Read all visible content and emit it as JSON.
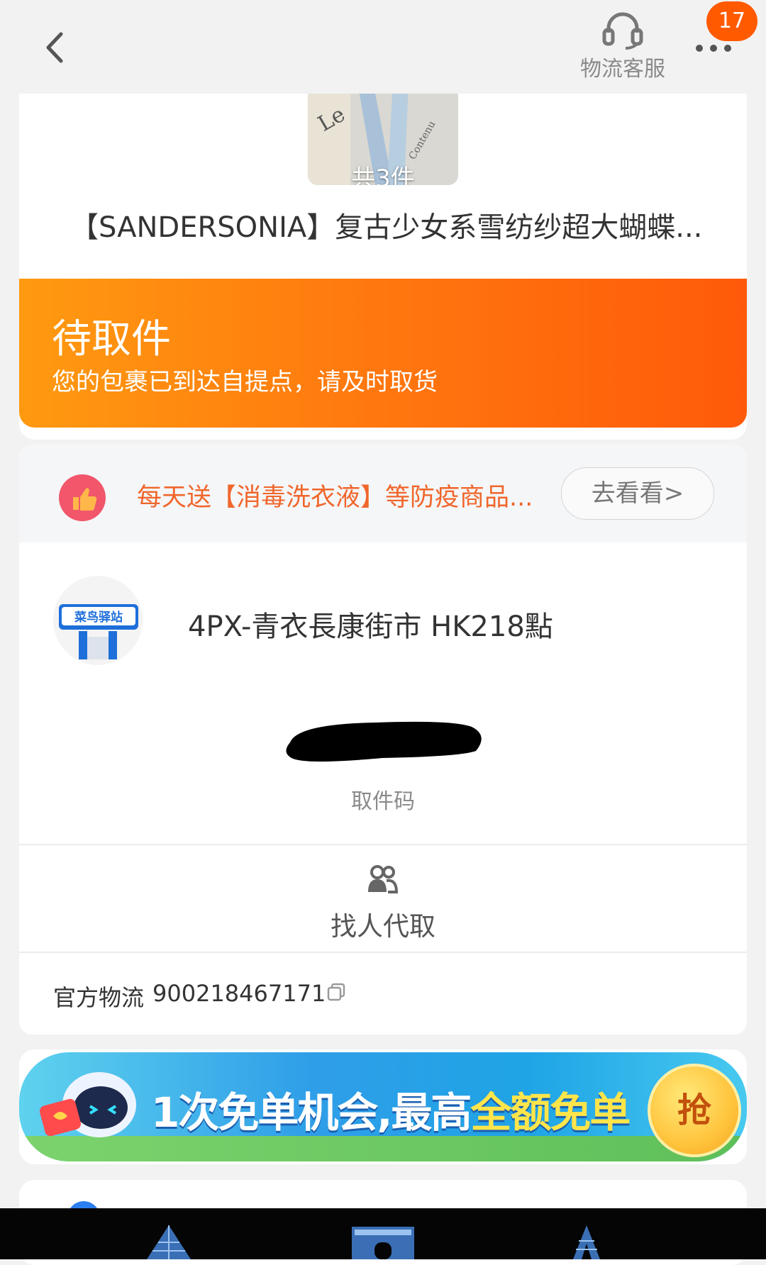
{
  "header": {
    "back_label": "",
    "customer_service_label": "物流客服",
    "message_badge": "17"
  },
  "product": {
    "thumbnail_count": "共3件",
    "title": "【SANDERSONIA】复古少女系雪纺纱超大蝴蝶..."
  },
  "status": {
    "title": "待取件",
    "subtitle": "您的包裹已到达自提点，请及时取货"
  },
  "promo": {
    "text": "每天送【消毒洗衣液】等防疫商品...",
    "button_label": "去看看>"
  },
  "pickup": {
    "logo_text": "菜鸟驿站",
    "station_name": "4PX-青衣長康街市 HK218點",
    "code_label": "取件码",
    "proxy_label": "找人代取",
    "tracking_label": "官方物流",
    "tracking_number": "900218467171"
  },
  "ad_banner": {
    "text_main": "1次免单机会,最高",
    "text_highlight": "全额免单",
    "button_label": "抢"
  },
  "colors": {
    "accent_orange": "#ff6a0a",
    "promo_text": "#f0662b",
    "badge": "#ff5a00"
  },
  "icons": [
    "back-arrow-icon",
    "headset-icon",
    "more-dots-icon",
    "thumbs-up-icon",
    "cainiao-station-icon",
    "people-icon",
    "copy-icon"
  ]
}
